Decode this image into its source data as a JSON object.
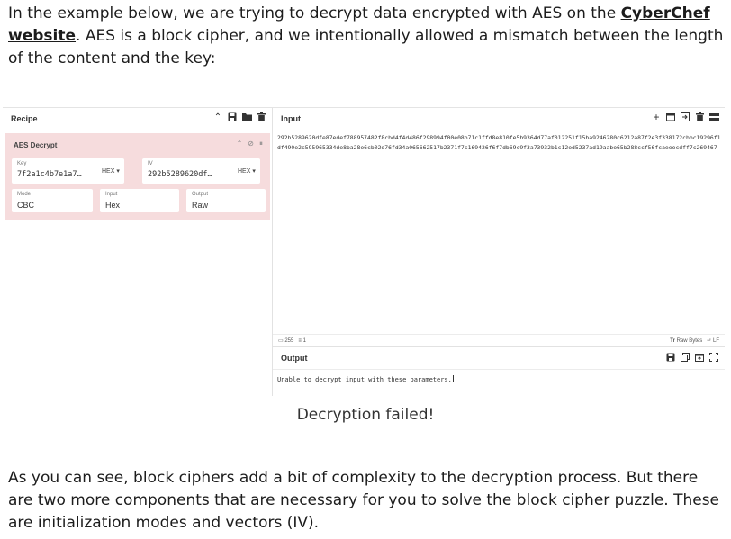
{
  "intro": {
    "before": "In the example below, we are trying to decrypt data encrypted with AES on the ",
    "link": "CyberChef website",
    "after": ". AES is a block cipher, and we intentionally allowed a mismatch between the length of the content and the key:"
  },
  "recipe": {
    "title": "Recipe",
    "operation": {
      "name": "AES Decrypt",
      "key_label": "Key",
      "key_value": "7f2a1c4b7e1a7…",
      "key_format": "HEX ▾",
      "iv_label": "IV",
      "iv_value": "292b5289620df…",
      "iv_format": "HEX ▾",
      "mode_label": "Mode",
      "mode_value": "CBC",
      "input_label": "Input",
      "input_value": "Hex",
      "output_label": "Output",
      "output_value": "Raw"
    }
  },
  "input": {
    "title": "Input",
    "text": "292b5289620dfe87edef788957482f8cbd4f4d486f298994f00e08b71c1ffd8e810fe5b9364d77af012251f15ba9246280c6212a87f2e3f338172cbbc19296f1df490e2c595965334de8ba28e6cb02d76fd34a065662517b2371f7c169426f6f7db69c9f3a73932b1c12ed5237ad19aabe65b288ccf56fcaeeecdff7c269467",
    "length": "255",
    "lines": "1",
    "raw_bytes": "Raw Bytes",
    "eol": "LF"
  },
  "output": {
    "title": "Output",
    "text": "Unable to decrypt input with these parameters."
  },
  "caption": "Decryption failed!",
  "outro": "As you can see, block ciphers add a bit of complexity to the decryption process. But there are two more components that are necessary for you to solve the block cipher puzzle. These are initialization modes and vectors (IV).",
  "icons": [
    "chevron-up-icon",
    "save-icon",
    "folder-icon",
    "trash-icon",
    "plus-icon",
    "new-tab-icon",
    "sign-in-icon",
    "list-icon",
    "disable-icon",
    "pause-icon",
    "copy-icon",
    "replace-input-icon",
    "maximise-icon"
  ]
}
